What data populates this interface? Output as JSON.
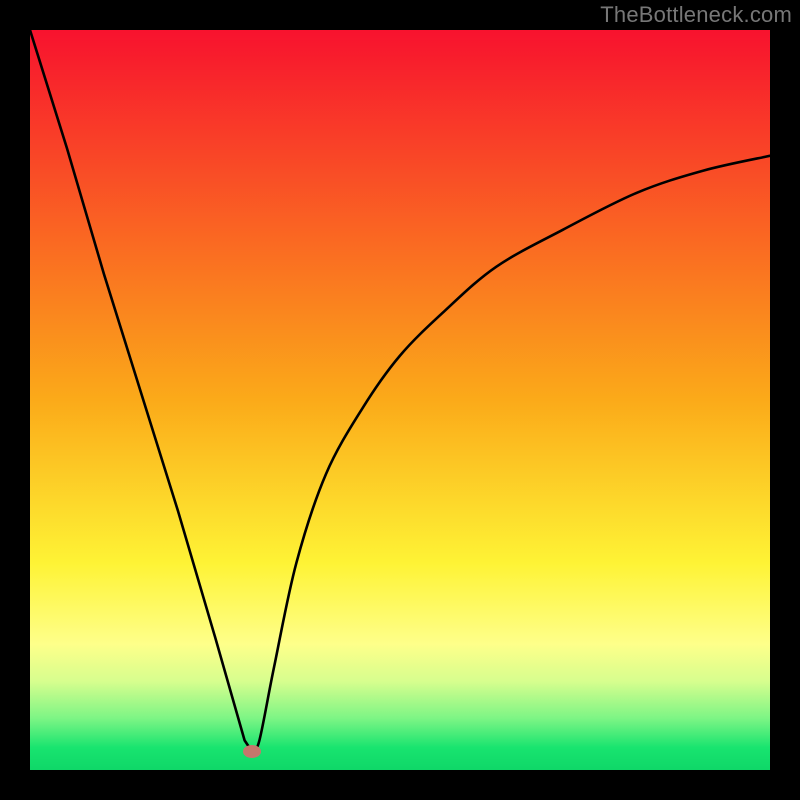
{
  "watermark": "TheBottleneck.com",
  "chart_data": {
    "type": "line",
    "title": "",
    "xlabel": "",
    "ylabel": "",
    "xlim": [
      0,
      100
    ],
    "ylim": [
      0,
      100
    ],
    "grid": false,
    "legend": false,
    "background": {
      "type": "vertical-gradient",
      "stops": [
        {
          "offset": 0.0,
          "color": "#f8122e"
        },
        {
          "offset": 0.5,
          "color": "#fbaa19"
        },
        {
          "offset": 0.72,
          "color": "#fef335"
        },
        {
          "offset": 0.83,
          "color": "#feff8a"
        },
        {
          "offset": 0.88,
          "color": "#d7fe8e"
        },
        {
          "offset": 0.93,
          "color": "#7df585"
        },
        {
          "offset": 0.97,
          "color": "#18e46f"
        },
        {
          "offset": 1.0,
          "color": "#0fd768"
        }
      ]
    },
    "marker": {
      "x": 30,
      "y": 97.5,
      "color": "#c6776c"
    },
    "series": [
      {
        "name": "bottleneck-curve",
        "color": "#000000",
        "piecewise": [
          {
            "segment": "left",
            "x": [
              0,
              30
            ],
            "y": [
              100,
              97.5
            ],
            "note": "linear descent from top-left to minimum"
          },
          {
            "segment": "right",
            "x": [
              30,
              100
            ],
            "y": [
              97.5,
              17
            ],
            "note": "steep rise then easing off (concave)"
          }
        ],
        "x": [
          0,
          5,
          10,
          15,
          20,
          25,
          29,
          30,
          31,
          33,
          36,
          40,
          45,
          50,
          56,
          63,
          72,
          82,
          91,
          100
        ],
        "y": [
          100,
          84,
          67,
          51,
          35,
          18,
          4,
          2.5,
          4,
          14,
          28,
          40,
          49,
          56,
          62,
          68,
          73,
          78,
          81,
          83
        ]
      }
    ]
  }
}
